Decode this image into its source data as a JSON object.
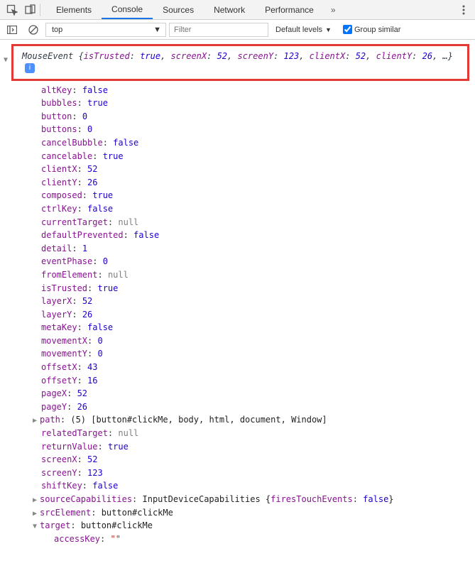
{
  "toolbar": {
    "tabs": [
      "Elements",
      "Console",
      "Sources",
      "Network",
      "Performance"
    ],
    "activeTab": "Console",
    "moreSymbol": "»"
  },
  "filterbar": {
    "context": "top",
    "filterPlaceholder": "Filter",
    "levels": "Default levels",
    "groupSimilar": "Group similar"
  },
  "summary": {
    "typeName": "MouseEvent",
    "parts": [
      {
        "k": "isTrusted",
        "v": "true",
        "t": "bool"
      },
      {
        "k": "screenX",
        "v": "52",
        "t": "num"
      },
      {
        "k": "screenY",
        "v": "123",
        "t": "num"
      },
      {
        "k": "clientX",
        "v": "52",
        "t": "num"
      },
      {
        "k": "clientY",
        "v": "26",
        "t": "num"
      }
    ],
    "ellipsis": ", …"
  },
  "props": [
    {
      "k": "altKey",
      "v": "false",
      "t": "bool"
    },
    {
      "k": "bubbles",
      "v": "true",
      "t": "bool"
    },
    {
      "k": "button",
      "v": "0",
      "t": "num"
    },
    {
      "k": "buttons",
      "v": "0",
      "t": "num"
    },
    {
      "k": "cancelBubble",
      "v": "false",
      "t": "bool"
    },
    {
      "k": "cancelable",
      "v": "true",
      "t": "bool"
    },
    {
      "k": "clientX",
      "v": "52",
      "t": "num"
    },
    {
      "k": "clientY",
      "v": "26",
      "t": "num"
    },
    {
      "k": "composed",
      "v": "true",
      "t": "bool"
    },
    {
      "k": "ctrlKey",
      "v": "false",
      "t": "bool"
    },
    {
      "k": "currentTarget",
      "v": "null",
      "t": "null"
    },
    {
      "k": "defaultPrevented",
      "v": "false",
      "t": "bool"
    },
    {
      "k": "detail",
      "v": "1",
      "t": "num"
    },
    {
      "k": "eventPhase",
      "v": "0",
      "t": "num"
    },
    {
      "k": "fromElement",
      "v": "null",
      "t": "null"
    },
    {
      "k": "isTrusted",
      "v": "true",
      "t": "bool"
    },
    {
      "k": "layerX",
      "v": "52",
      "t": "num"
    },
    {
      "k": "layerY",
      "v": "26",
      "t": "num"
    },
    {
      "k": "metaKey",
      "v": "false",
      "t": "bool"
    },
    {
      "k": "movementX",
      "v": "0",
      "t": "num"
    },
    {
      "k": "movementY",
      "v": "0",
      "t": "num"
    },
    {
      "k": "offsetX",
      "v": "43",
      "t": "num"
    },
    {
      "k": "offsetY",
      "v": "16",
      "t": "num"
    },
    {
      "k": "pageX",
      "v": "52",
      "t": "num"
    },
    {
      "k": "pageY",
      "v": "26",
      "t": "num"
    }
  ],
  "pathRow": {
    "key": "path",
    "count": "(5)",
    "items": [
      "button#clickMe",
      "body",
      "html",
      "document",
      "Window"
    ]
  },
  "props2": [
    {
      "k": "relatedTarget",
      "v": "null",
      "t": "null"
    },
    {
      "k": "returnValue",
      "v": "true",
      "t": "bool"
    },
    {
      "k": "screenX",
      "v": "52",
      "t": "num"
    },
    {
      "k": "screenY",
      "v": "123",
      "t": "num"
    },
    {
      "k": "shiftKey",
      "v": "false",
      "t": "bool"
    }
  ],
  "sourceCaps": {
    "key": "sourceCapabilities",
    "type": "InputDeviceCapabilities",
    "innerKey": "firesTouchEvents",
    "innerVal": "false"
  },
  "srcElement": {
    "key": "srcElement",
    "val": "button#clickMe"
  },
  "target": {
    "key": "target",
    "val": "button#clickMe"
  },
  "targetChildren": [
    {
      "k": "accessKey",
      "v": "\"\"",
      "t": "str"
    }
  ]
}
